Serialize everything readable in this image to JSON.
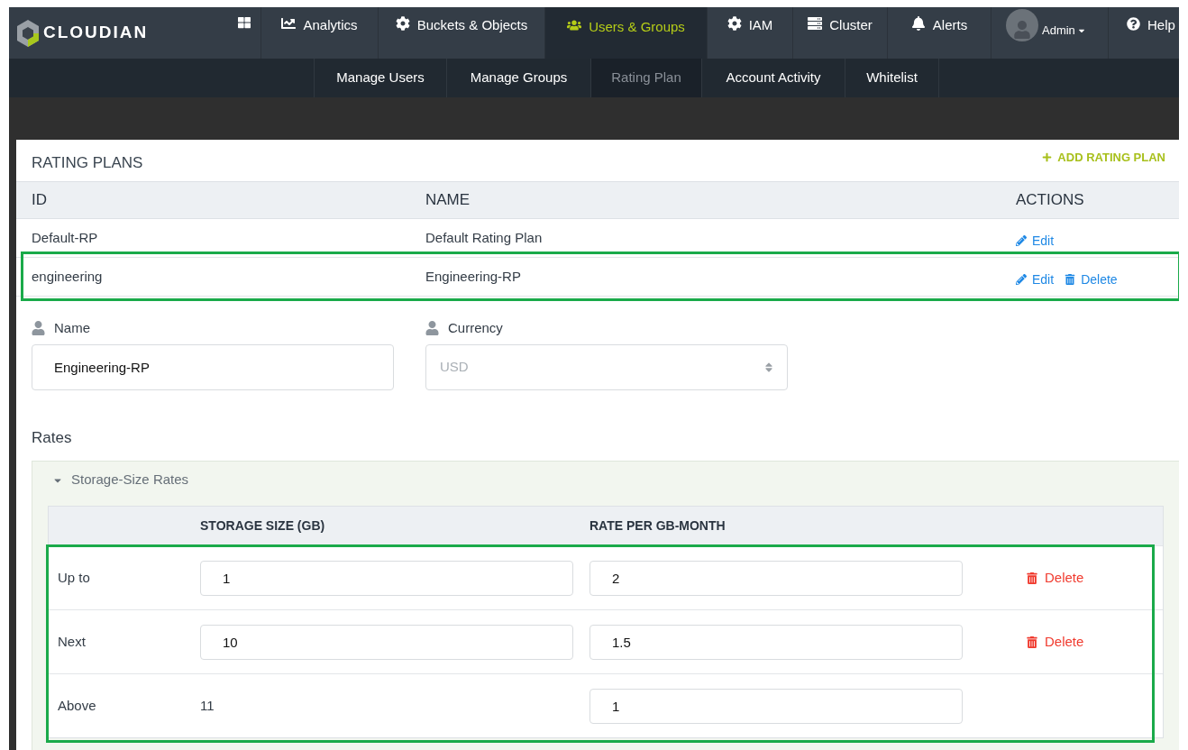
{
  "nav": {
    "logo": "CLOUDIAN",
    "items": [
      {
        "label": "Analytics",
        "selected": false
      },
      {
        "label": "Buckets & Objects",
        "selected": false
      },
      {
        "label": "Users & Groups",
        "selected": true
      },
      {
        "label": "IAM",
        "selected": false
      },
      {
        "label": "Cluster",
        "selected": false
      },
      {
        "label": "Alerts",
        "selected": false
      }
    ],
    "user_menu": {
      "label": "Admin"
    },
    "help": {
      "label": "Help"
    }
  },
  "subnav": [
    {
      "label": "Manage Users",
      "selected": false
    },
    {
      "label": "Manage Groups",
      "selected": false
    },
    {
      "label": "Rating Plan",
      "selected": true
    },
    {
      "label": "Account Activity",
      "selected": false
    },
    {
      "label": "Whitelist",
      "selected": false
    }
  ],
  "rating_plans": {
    "title": "RATING PLANS",
    "add_button": "ADD RATING PLAN",
    "columns": [
      "ID",
      "NAME",
      "ACTIONS"
    ],
    "rows": [
      {
        "id": "Default-RP",
        "name": "Default Rating Plan",
        "highlighted": false,
        "actions": [
          {
            "kind": "edit",
            "label": "Edit"
          }
        ]
      },
      {
        "id": "engineering",
        "name": "Engineering-RP",
        "highlighted": true,
        "actions": [
          {
            "kind": "edit",
            "label": "Edit"
          },
          {
            "kind": "delete",
            "label": "Delete"
          }
        ]
      }
    ]
  },
  "form": {
    "name": {
      "label": "Name",
      "value": "Engineering-RP"
    },
    "currency": {
      "label": "Currency",
      "value": "USD",
      "disabled": true
    }
  },
  "rates": {
    "title": "Rates",
    "section": {
      "title": "Storage-Size Rates",
      "expanded": true,
      "highlighted": true,
      "columns": [
        "STORAGE SIZE (GB)",
        "RATE PER GB-MONTH"
      ],
      "rows": [
        {
          "label": "Up to",
          "size_editable": true,
          "size": "1",
          "rate": "2",
          "delete": "Delete"
        },
        {
          "label": "Next",
          "size_editable": true,
          "size": "10",
          "rate": "1.5",
          "delete": "Delete"
        },
        {
          "label": "Above",
          "size_editable": false,
          "size": "11",
          "rate": "1"
        }
      ]
    }
  }
}
